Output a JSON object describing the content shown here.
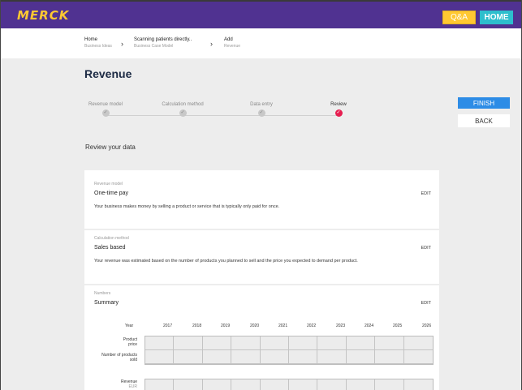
{
  "brand": {
    "logo_text": "MERCK",
    "qa_label": "Q&A",
    "home_label": "HOME"
  },
  "breadcrumb": [
    {
      "main": "Home",
      "sub": "Business Ideas"
    },
    {
      "main": "Scanning patients directly..",
      "sub": "Business Case Model"
    },
    {
      "main": "Add",
      "sub": "Revenue"
    }
  ],
  "page_title": "Revenue",
  "steps": [
    {
      "label": "Revenue model",
      "mark": "✓"
    },
    {
      "label": "Calculation method",
      "mark": "✓"
    },
    {
      "label": "Data entry",
      "mark": "✓"
    },
    {
      "label": "Review",
      "mark": "✓"
    }
  ],
  "actions": {
    "finish": "FINISH",
    "back": "BACK"
  },
  "review_heading": "Review your data",
  "cards": [
    {
      "label": "Revenue model",
      "title": "One-time pay",
      "desc": "Your business makes money by selling a product or service that is typically only paid for once.",
      "edit": "EDIT"
    },
    {
      "label": "Calculation method",
      "title": "Sales based",
      "desc": "Your revenue was estimated based on the number of products you planned to sell and the price you expected to demand per product.",
      "edit": "EDIT"
    },
    {
      "label": "Numbers",
      "title": "Summary",
      "edit": "EDIT"
    }
  ],
  "table": {
    "year_label": "Year",
    "years": [
      "2017",
      "2018",
      "2019",
      "2020",
      "2021",
      "2022",
      "2023",
      "2024",
      "2025",
      "2026"
    ],
    "row1a": "Product",
    "row1b": "price",
    "row2": "Number of products",
    "row2b": "sold",
    "row3": "Revenue",
    "row3b": "EUR"
  },
  "colors": {
    "brand_purple": "#503291",
    "brand_yellow": "#ffc832",
    "accent_teal": "#2dbecd",
    "active_step": "#e61e50",
    "finish_blue": "#2d8ce6"
  }
}
